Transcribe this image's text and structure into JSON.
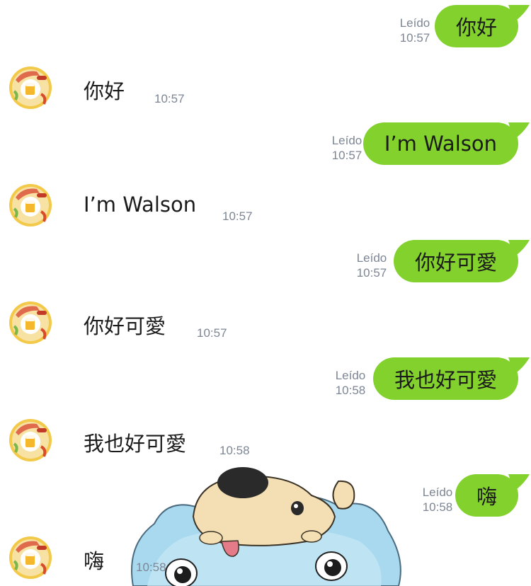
{
  "colors": {
    "outgoing_bubble": "#82d12c",
    "meta_text": "#7d8694",
    "text": "#1b1b1b",
    "background": "#ffffff"
  },
  "messages": [
    {
      "dir": "out",
      "text": "你好",
      "read": "Leído",
      "time": "10:57"
    },
    {
      "dir": "in",
      "text": "你好",
      "time": "10:57"
    },
    {
      "dir": "out",
      "text": "I’m Walson",
      "read": "Leído",
      "time": "10:57"
    },
    {
      "dir": "in",
      "text": "I’m Walson",
      "time": "10:57"
    },
    {
      "dir": "out",
      "text": "你好可愛",
      "read": "Leído",
      "time": "10:57"
    },
    {
      "dir": "in",
      "text": "你好可愛",
      "time": "10:57"
    },
    {
      "dir": "out",
      "text": "我也好可愛",
      "read": "Leído",
      "time": "10:58"
    },
    {
      "dir": "in",
      "text": "我也好可愛",
      "time": "10:58"
    },
    {
      "dir": "out",
      "text": "嗨",
      "read": "Leído",
      "time": "10:58"
    },
    {
      "dir": "in",
      "text": "嗨",
      "time": "10:58"
    }
  ],
  "sticker": {
    "icon": "puppy-on-blue-creature-sticker"
  },
  "avatar": {
    "icon": "food-plate-avatar"
  }
}
